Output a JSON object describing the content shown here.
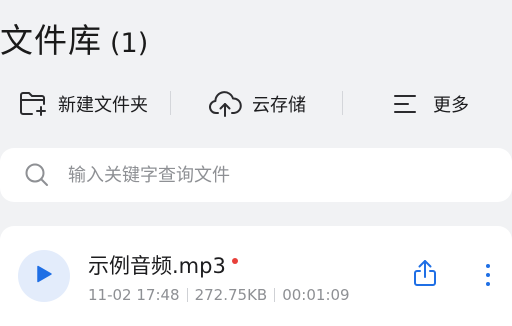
{
  "header": {
    "title": "文件库",
    "count": "(1)"
  },
  "toolbar": {
    "new_folder": {
      "label": "新建文件夹",
      "icon": "folder-plus-icon"
    },
    "cloud_storage": {
      "label": "云存储",
      "icon": "cloud-upload-icon"
    },
    "more": {
      "label": "更多",
      "icon": "menu-lines-icon"
    }
  },
  "search": {
    "placeholder": "输入关键字查询文件",
    "value": ""
  },
  "files": [
    {
      "name": "示例音频.mp3",
      "date": "11-02 17:48",
      "size": "272.75KB",
      "duration": "00:01:09",
      "is_new": true
    }
  ],
  "colors": {
    "accent": "#1f6fe5",
    "play_bg": "#e3ecfb",
    "new_dot": "#e8403a",
    "page_bg": "#f1f2f4"
  }
}
